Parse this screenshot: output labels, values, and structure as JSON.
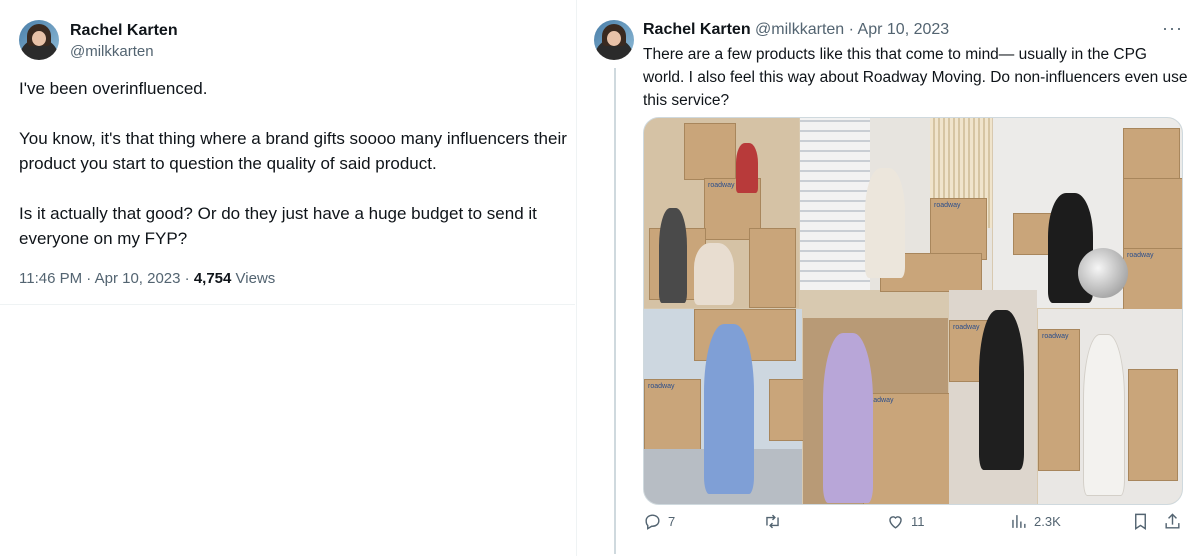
{
  "left_tweet": {
    "author_name": "Rachel Karten",
    "author_handle": "@milkkarten",
    "text": "I've been overinfluenced.\n\nYou know, it's that thing where a brand gifts soooo many influencers their product you start to question the quality of said product.\n\nIs it actually that good? Or do they just have a huge budget to send it everyone on my FYP?",
    "time": "11:46 PM · Apr 10, 2023 · ",
    "views_count": "4,754",
    "views_label": " Views"
  },
  "right_tweet": {
    "author_name": "Rachel Karten",
    "author_handle": "@milkkarten",
    "date": "Apr 10, 2023",
    "separator": "·",
    "more_label": "···",
    "text": "There are a few products like this that come to mind— usually in the CPG world. I also feel this way about Roadway Moving. Do non-influencers even use this service?",
    "media_alt": "Collage of influencers posing with Roadway moving boxes",
    "box_brand": "roadway",
    "actions": {
      "reply_count": "7",
      "retweet_count": "",
      "like_count": "11",
      "views_count": "2.3K"
    }
  },
  "icons": [
    "avatar",
    "more-icon",
    "reply-icon",
    "retweet-icon",
    "like-icon",
    "views-icon",
    "bookmark-icon",
    "share-icon"
  ]
}
